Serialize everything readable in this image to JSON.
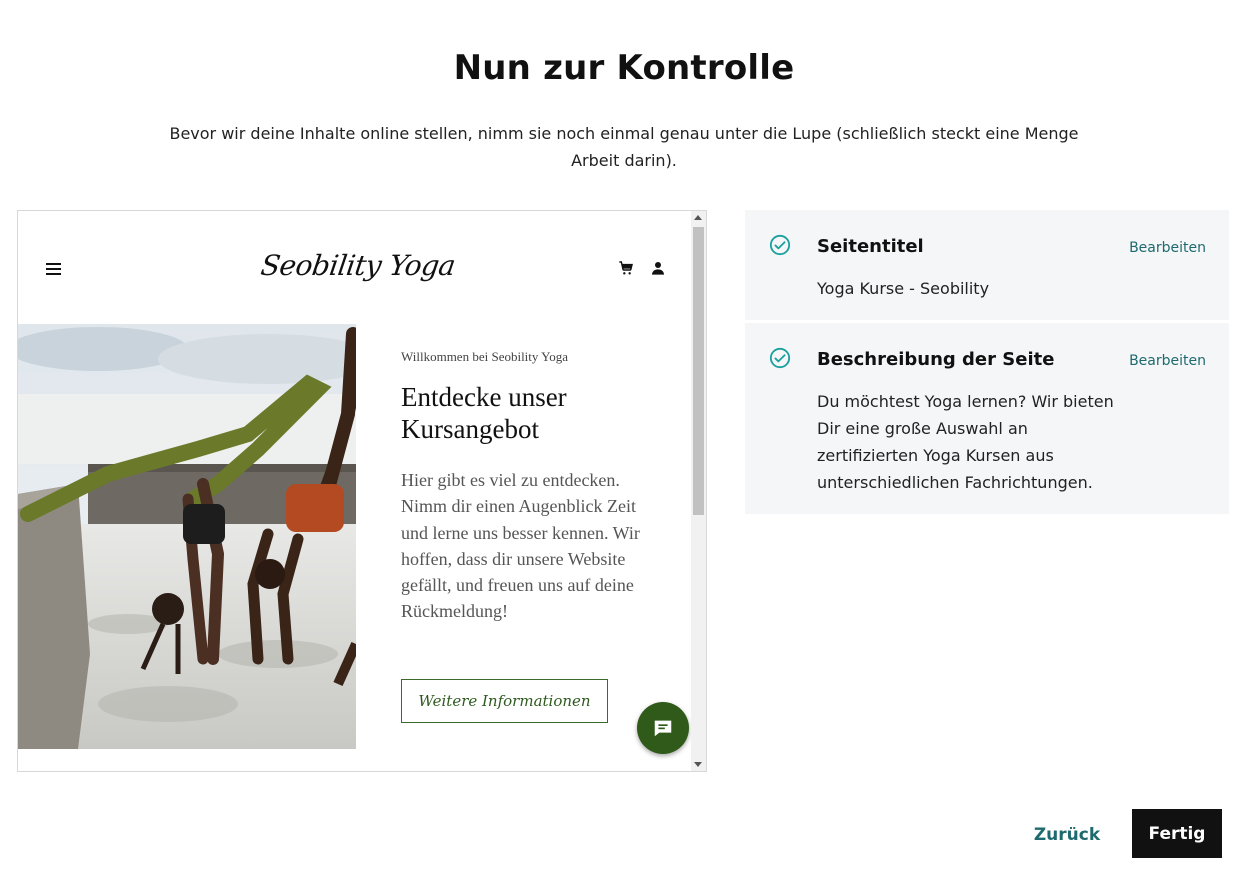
{
  "header": {
    "title": "Nun zur Kontrolle",
    "subtitle": "Bevor wir deine Inhalte online stellen, nimm sie noch einmal genau unter die Lupe (schließlich steckt eine Menge Arbeit darin)."
  },
  "preview": {
    "site_logo": "Seobility Yoga",
    "icons": [
      "menu-icon",
      "cart-icon",
      "user-icon",
      "chat-icon"
    ],
    "hero": {
      "eyebrow": "Willkommen bei Seobility Yoga",
      "heading": "Entdecke unser Kursangebot",
      "body": "Hier gibt es viel zu entdecken. Nimm dir einen Augenblick Zeit und lerne uns besser kennen. Wir hoffen, dass dir unsere Website gefällt, und freuen uns auf deine Rückmeldung!",
      "button_label": "Weitere Informationen"
    },
    "accent_color": "#2f5a1a"
  },
  "review": {
    "items": [
      {
        "title": "Seitentitel",
        "edit_label": "Bearbeiten",
        "value": "Yoga Kurse - Seobility"
      },
      {
        "title": "Beschreibung der Seite",
        "edit_label": "Bearbeiten",
        "value": "Du möchtest Yoga lernen? Wir bieten Dir eine große Auswahl an zertifizierten Yoga Kursen aus unterschiedlichen Fachrichtungen."
      }
    ],
    "check_color": "#1aa0a0"
  },
  "footer": {
    "back_label": "Zurück",
    "done_label": "Fertig"
  }
}
